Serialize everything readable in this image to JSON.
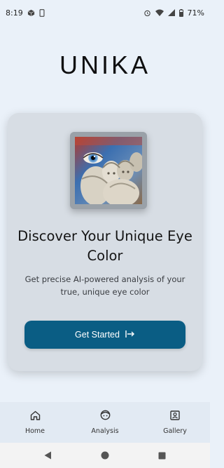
{
  "status_bar": {
    "time": "8:19",
    "battery": "71%",
    "icons": [
      "cube-notification-icon",
      "phone-notification-icon",
      "alarm-icon",
      "wifi-icon",
      "signal-icon",
      "battery-icon"
    ]
  },
  "app": {
    "title": "UNIKA"
  },
  "card": {
    "title": "Discover Your Unique Eye Color",
    "subtitle": "Get precise AI-powered analysis of your true, unique eye color",
    "button_label": "Get Started",
    "button_icon": "arrow-right-bar-icon",
    "hero_image": "sculpture-eye-collage"
  },
  "bottom_nav": {
    "items": [
      {
        "label": "Home",
        "icon": "home-icon"
      },
      {
        "label": "Analysis",
        "icon": "face-icon"
      },
      {
        "label": "Gallery",
        "icon": "portrait-icon"
      }
    ]
  },
  "system_nav": {
    "icons": [
      "back-triangle-icon",
      "home-circle-icon",
      "recents-square-icon"
    ]
  },
  "colors": {
    "background": "#eaf1f9",
    "card": "#d7dde4",
    "primary_button": "#0a5d84"
  }
}
